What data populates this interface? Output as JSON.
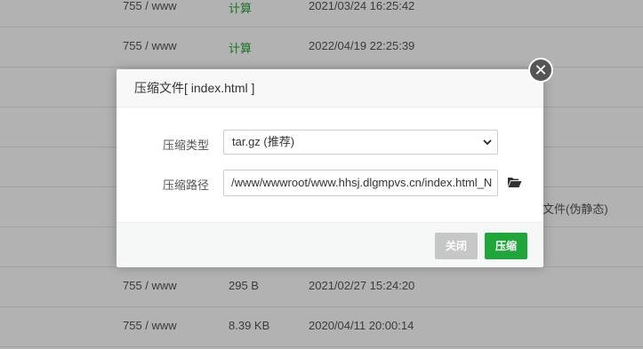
{
  "background_rows": [
    {
      "perm": "755 / www",
      "size": "计算",
      "time": "2021/03/24 16:25:42",
      "size_green": true
    },
    {
      "perm": "755 / www",
      "size": "计算",
      "time": "2022/04/19 22:25:39",
      "size_green": true
    },
    {
      "perm": "",
      "size": "",
      "time": "",
      "size_green": false
    },
    {
      "perm": "",
      "size": "",
      "time": "",
      "size_green": false
    },
    {
      "perm": "",
      "size": "",
      "time": "",
      "size_green": false
    },
    {
      "perm": "",
      "size": "",
      "time": "",
      "size_green": false
    },
    {
      "perm": "",
      "size": "",
      "time": "",
      "size_green": false
    },
    {
      "perm": "755 / www",
      "size": "295 B",
      "time": "2021/02/27 15:24:20",
      "size_green": false
    },
    {
      "perm": "755 / www",
      "size": "8.39 KB",
      "time": "2020/04/11 20:00:14",
      "size_green": false
    }
  ],
  "background_side_text": "文件(伪静态)",
  "dialog": {
    "title": "压缩文件[ index.html ]",
    "close_icon": "close-icon",
    "type_label": "压缩类型",
    "type_value": "tar.gz (推荐)",
    "path_label": "压缩路径",
    "path_value": "/www/wwwroot/www.hhsj.dlgmpvs.cn/index.html_N",
    "folder_icon": "folder-open-icon",
    "close_button": "关闭",
    "compress_button": "压缩"
  },
  "colors": {
    "accent": "#20a53a",
    "disabled_button": "#c7c7c7",
    "overlay": "rgba(0,0,0,0.3)"
  }
}
